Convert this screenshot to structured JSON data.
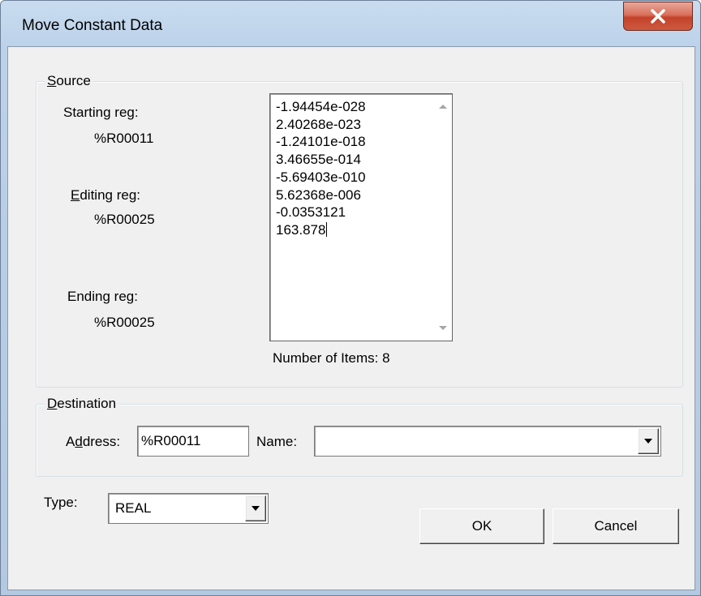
{
  "window": {
    "title": "Move Constant Data"
  },
  "source": {
    "legend_mnemonic": "S",
    "legend_rest": "ource",
    "starting_reg_label": "Starting reg:",
    "starting_reg_value": "%R00011",
    "editing_reg_label_mnemonic": "E",
    "editing_reg_label_rest": "diting reg:",
    "editing_reg_value": "%R00025",
    "ending_reg_label": "Ending reg:",
    "ending_reg_value": "%R00025",
    "items": [
      "-1.94454e-028",
      "2.40268e-023",
      "-1.24101e-018",
      "3.46655e-014",
      "-5.69403e-010",
      "5.62368e-006",
      "-0.0353121",
      "163.878"
    ],
    "count_label": "Number of Items: 8"
  },
  "destination": {
    "legend_mnemonic": "D",
    "legend_rest": "estination",
    "address_label_pre": "A",
    "address_label_mnemonic": "d",
    "address_label_post": "dress:",
    "address_value": "%R00011",
    "name_label": "Name:",
    "name_value": ""
  },
  "type": {
    "label": "Type:",
    "selected": "REAL"
  },
  "buttons": {
    "ok": "OK",
    "cancel": "Cancel"
  },
  "colors": {
    "close_button": "#c7472f",
    "dialog_background": "#f0f0f0",
    "frame": "#b9cfe7"
  }
}
